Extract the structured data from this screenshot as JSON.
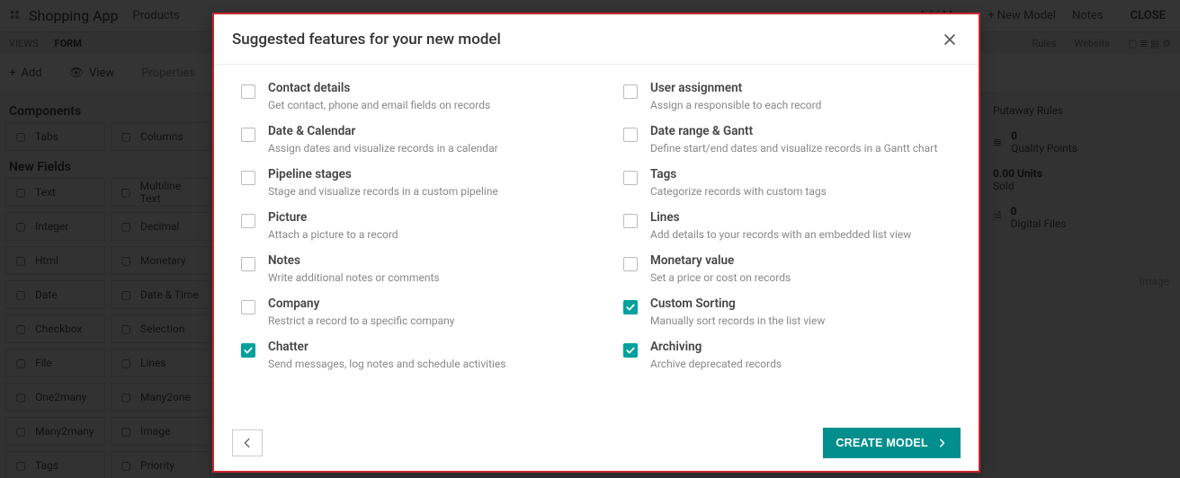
{
  "app": {
    "title": "Shopping App",
    "crumb": "Products",
    "topRight": {
      "addMenu": "Add Menu",
      "newModel": "New Model",
      "notes": "Notes",
      "close": "CLOSE"
    }
  },
  "viewTabs": {
    "views": "VIEWS",
    "form": "FORM"
  },
  "toolbar": {
    "add": "Add",
    "view": "View",
    "props": "Properties"
  },
  "componentsHeader": "Components",
  "newFieldsHeader": "New Fields",
  "componentRows": [
    [
      {
        "icon": "tabs",
        "label": "Tabs"
      },
      {
        "icon": "columns",
        "label": "Columns"
      }
    ]
  ],
  "fieldRows": [
    [
      {
        "icon": "text",
        "label": "Text"
      },
      {
        "icon": "multiline",
        "label": "Multiline Text"
      }
    ],
    [
      {
        "icon": "integer",
        "label": "Integer"
      },
      {
        "icon": "decimal",
        "label": "Decimal"
      }
    ],
    [
      {
        "icon": "html",
        "label": "Html"
      },
      {
        "icon": "money",
        "label": "Monetary"
      }
    ],
    [
      {
        "icon": "date",
        "label": "Date"
      },
      {
        "icon": "datetime",
        "label": "Date & Time"
      }
    ],
    [
      {
        "icon": "checkbox",
        "label": "Checkbox"
      },
      {
        "icon": "selection",
        "label": "Selection"
      }
    ],
    [
      {
        "icon": "file",
        "label": "File"
      },
      {
        "icon": "lines",
        "label": "Lines"
      }
    ],
    [
      {
        "icon": "one2many",
        "label": "One2many"
      },
      {
        "icon": "many2one",
        "label": "Many2one"
      }
    ],
    [
      {
        "icon": "many2many",
        "label": "Many2many"
      },
      {
        "icon": "image",
        "label": "Image"
      }
    ],
    [
      {
        "icon": "tags",
        "label": "Tags"
      },
      {
        "icon": "priority",
        "label": "Priority"
      }
    ]
  ],
  "rightPanel": {
    "rulesLink": "Putaway Rules",
    "sold": {
      "num": "0.00 Units",
      "label": "Sold"
    },
    "quality": {
      "num": "0",
      "label": "Quality Points"
    },
    "files": {
      "num": "0",
      "label": "Digital Files"
    },
    "image": "Image"
  },
  "tabsStrip": [
    "Rules",
    "Website"
  ],
  "modal": {
    "title": "Suggested features for your new model",
    "features": [
      {
        "checked": false,
        "label": "Contact details",
        "desc": "Get contact, phone and email fields on records"
      },
      {
        "checked": false,
        "label": "User assignment",
        "desc": "Assign a responsible to each record"
      },
      {
        "checked": false,
        "label": "Date & Calendar",
        "desc": "Assign dates and visualize records in a calendar"
      },
      {
        "checked": false,
        "label": "Date range & Gantt",
        "desc": "Define start/end dates and visualize records in a Gantt chart"
      },
      {
        "checked": false,
        "label": "Pipeline stages",
        "desc": "Stage and visualize records in a custom pipeline"
      },
      {
        "checked": false,
        "label": "Tags",
        "desc": "Categorize records with custom tags"
      },
      {
        "checked": false,
        "label": "Picture",
        "desc": "Attach a picture to a record"
      },
      {
        "checked": false,
        "label": "Lines",
        "desc": "Add details to your records with an embedded list view"
      },
      {
        "checked": false,
        "label": "Notes",
        "desc": "Write additional notes or comments"
      },
      {
        "checked": false,
        "label": "Monetary value",
        "desc": "Set a price or cost on records"
      },
      {
        "checked": false,
        "label": "Company",
        "desc": "Restrict a record to a specific company"
      },
      {
        "checked": true,
        "label": "Custom Sorting",
        "desc": "Manually sort records in the list view"
      },
      {
        "checked": true,
        "label": "Chatter",
        "desc": "Send messages, log notes and schedule activities"
      },
      {
        "checked": true,
        "label": "Archiving",
        "desc": "Archive deprecated records"
      }
    ],
    "back": "Back",
    "create": "CREATE MODEL"
  }
}
